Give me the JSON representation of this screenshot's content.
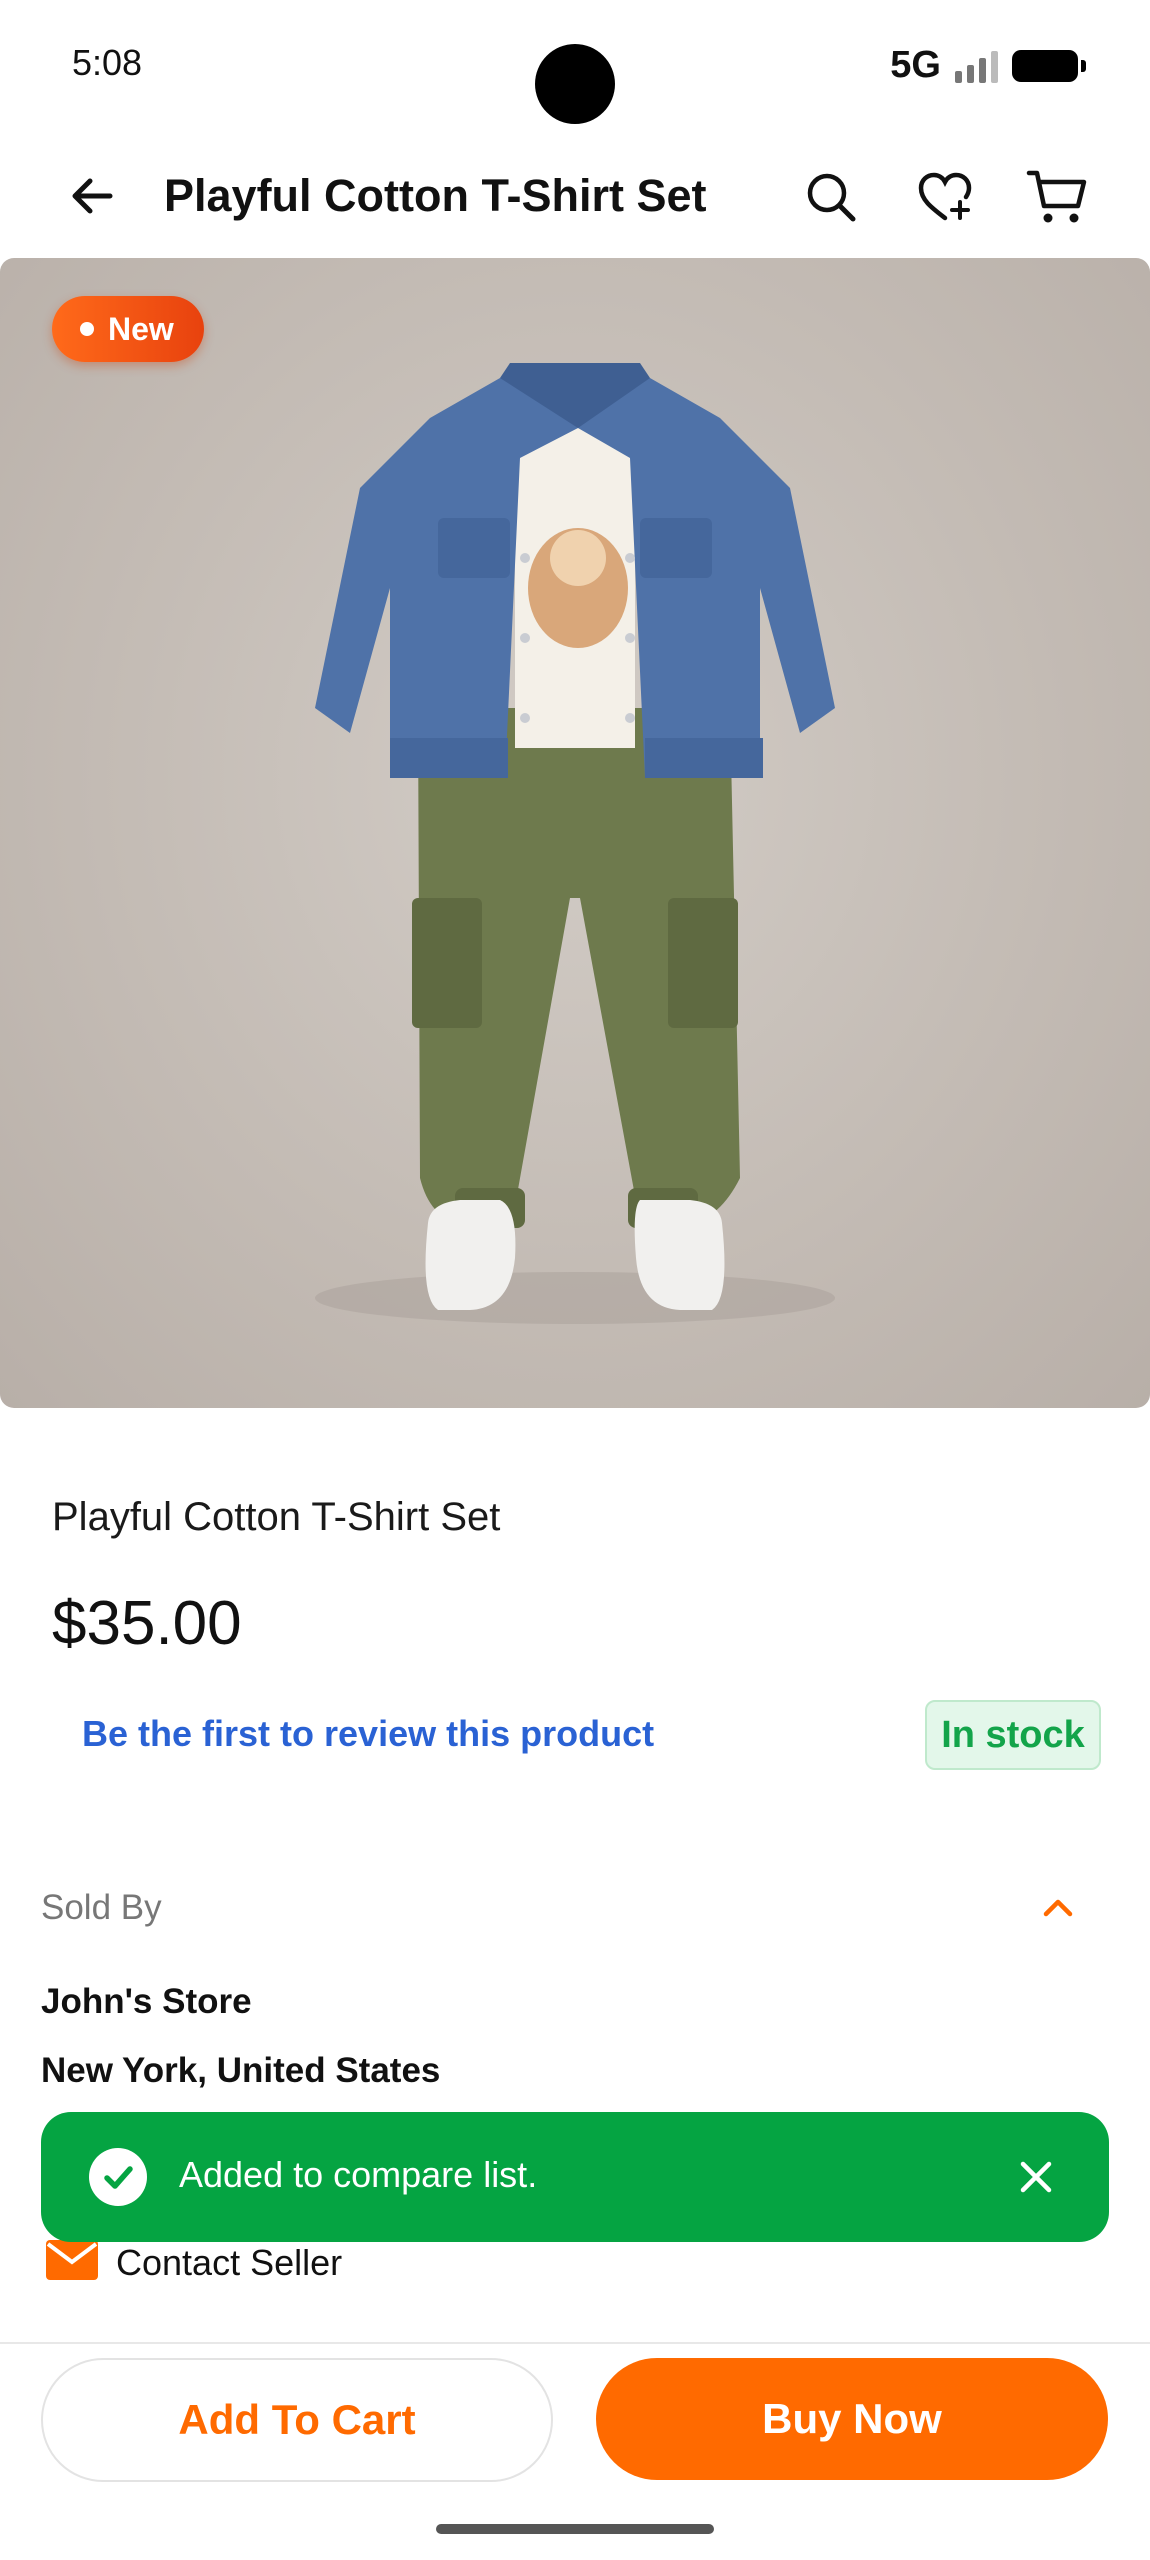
{
  "status_bar": {
    "time": "5:08",
    "network": "5G"
  },
  "header": {
    "title": "Playful Cotton T-Shirt Set"
  },
  "product": {
    "badge": "New",
    "name": "Playful Cotton T-Shirt Set",
    "price": "$35.00",
    "review_link": "Be the first to review this product",
    "stock_status": "In stock"
  },
  "seller": {
    "section_label": "Sold By",
    "store_name": "John's Store",
    "location": "New York, United States",
    "contact_label": "Contact Seller"
  },
  "toast": {
    "message": "Added to compare list."
  },
  "actions": {
    "add_to_cart": "Add To Cart",
    "buy_now": "Buy Now"
  },
  "colors": {
    "accent": "#ff6a00",
    "toast_green": "#05a442",
    "link_blue": "#2a62d4",
    "stock_green": "#13a44a"
  }
}
